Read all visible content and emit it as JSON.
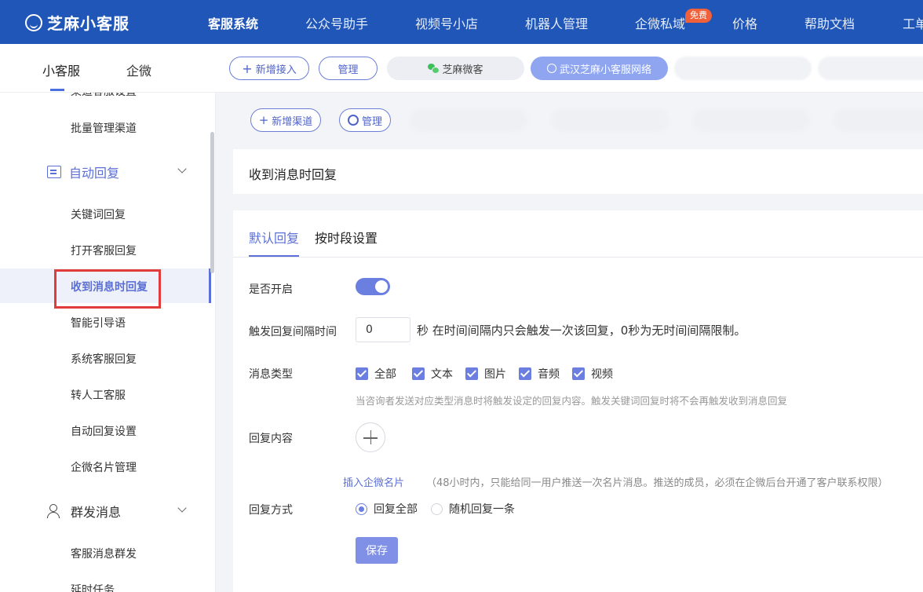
{
  "topnav": {
    "logo": "芝麻小客服",
    "items": [
      "客服系统",
      "公众号助手",
      "视频号小店",
      "机器人管理",
      "企微私域",
      "价格",
      "帮助文档",
      "工单"
    ],
    "badge": "免费"
  },
  "subheader": {
    "tabs": [
      "小客服",
      "企微"
    ],
    "add_button": "新增接入",
    "manage_button": "管理",
    "account_wechat": "芝麻微客",
    "account_active": "武汉芝麻小客服网络"
  },
  "sidebar": {
    "items": {
      "channel_settings": "渠道客服设置",
      "batch_channels": "批量管理渠道",
      "auto_reply_group": "自动回复",
      "keyword_reply": "关键词回复",
      "open_reply": "打开客服回复",
      "msg_reply": "收到消息时回复",
      "smart_guide": "智能引导语",
      "system_reply": "系统客服回复",
      "transfer": "转人工客服",
      "auto_settings": "自动回复设置",
      "card_mgmt": "企微名片管理",
      "mass_group": "群发消息",
      "mass_send": "客服消息群发",
      "delay_task": "延时任务"
    }
  },
  "channels": {
    "add": "新增渠道",
    "manage": "管理"
  },
  "page": {
    "title": "收到消息时回复",
    "tabs": [
      "默认回复",
      "按时段设置"
    ],
    "form": {
      "enable_label": "是否开启",
      "interval_label": "触发回复间隔时间",
      "interval_value": "0",
      "interval_suffix": "秒 在时间间隔内只会触发一次该回复，0秒为无时间间隔限制。",
      "msg_type_label": "消息类型",
      "types": [
        "全部",
        "文本",
        "图片",
        "音频",
        "视频"
      ],
      "hint": "当咨询者发送对应类型消息时将触发设定的回复内容。触发关键词回复时将不会再触发收到消息回复",
      "content_label": "回复内容",
      "insert_card": "插入企微名片",
      "card_note": "（48小时内，只能给同一用户推送一次名片消息。推送的成员，必须在企微后台开通了客户联系权限）",
      "mode_label": "回复方式",
      "mode_all": "回复全部",
      "mode_random": "随机回复一条",
      "save": "保存"
    }
  },
  "colors": {
    "nav": "#1f56b7",
    "accent": "#5b6fd6",
    "highlight_box": "#e23b3b"
  }
}
